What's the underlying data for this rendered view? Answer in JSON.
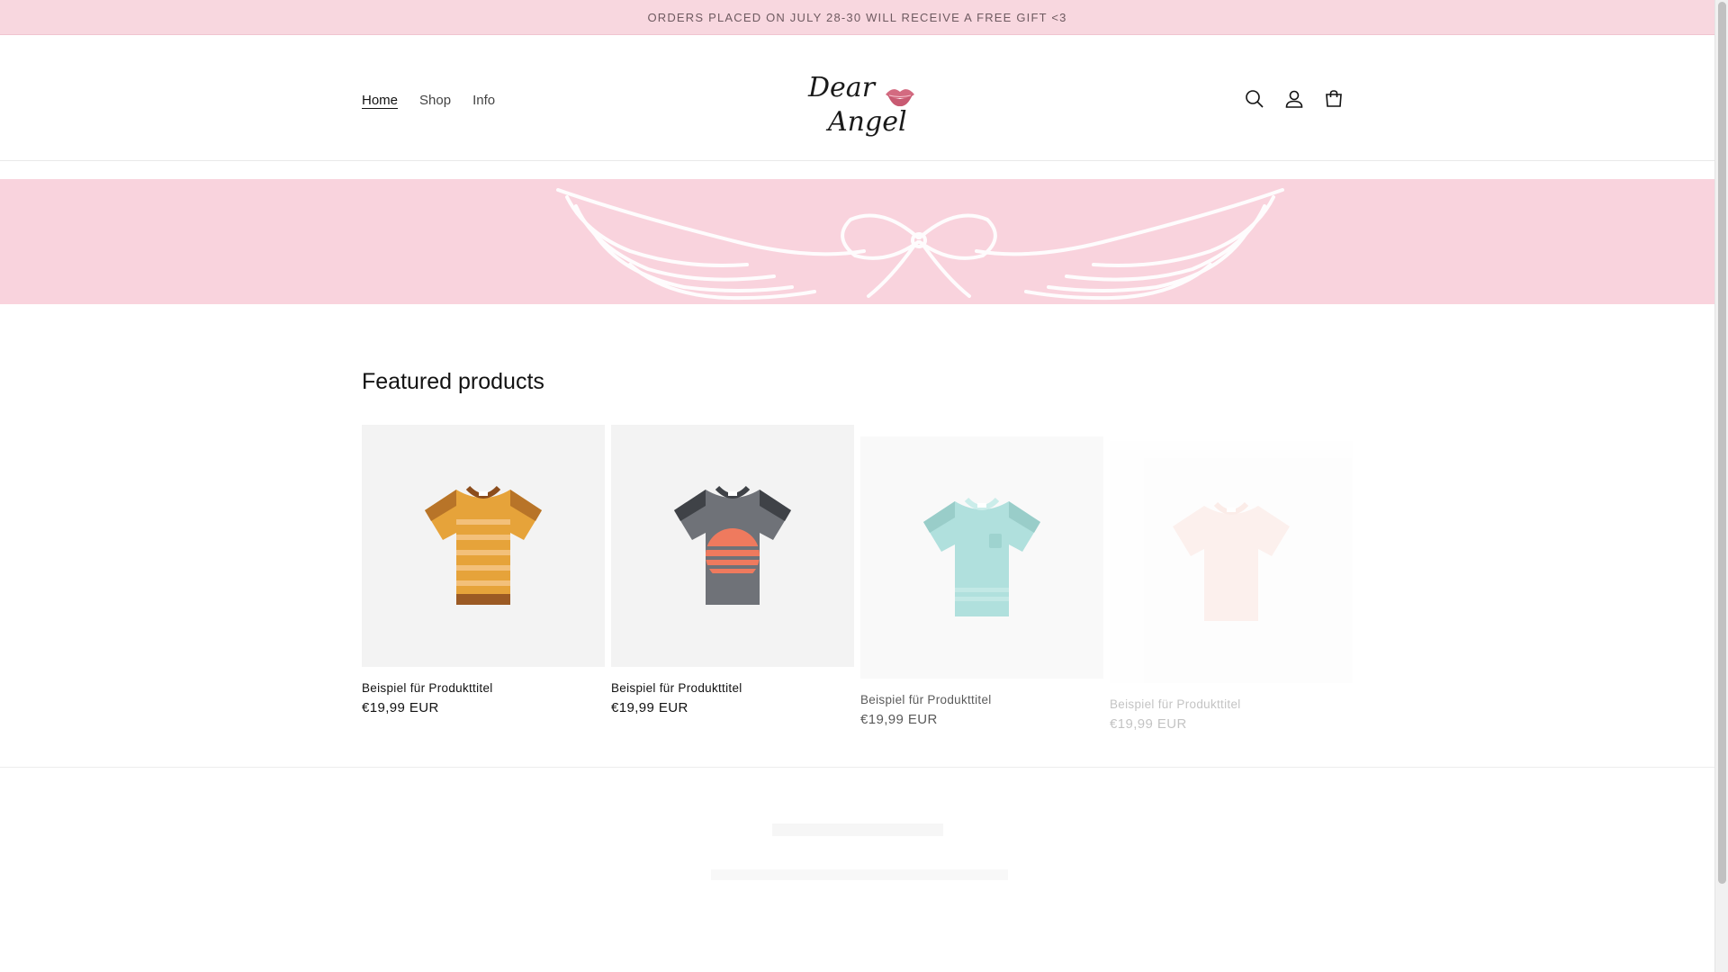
{
  "announcement": {
    "text": "ORDERS PLACED ON JULY 28-30 WILL RECEIVE A FREE GIFT <3"
  },
  "nav": {
    "items": [
      {
        "label": "Home",
        "active": true
      },
      {
        "label": "Shop",
        "active": false
      },
      {
        "label": "Info",
        "active": false
      }
    ]
  },
  "logo": {
    "line1": "Dear",
    "line2": "Angel",
    "accent": "#d36a80"
  },
  "header_icons": [
    "search-icon",
    "account-icon",
    "cart-icon"
  ],
  "hero": {
    "background": "#f9d3dd",
    "graphic": "wings-with-bow"
  },
  "featured": {
    "heading": "Featured products",
    "products": [
      {
        "title": "Beispiel für Produkttitel",
        "price": "€19,99 EUR",
        "shirt": "orange-striped"
      },
      {
        "title": "Beispiel für Produkttitel",
        "price": "€19,99 EUR",
        "shirt": "gray-sunset"
      },
      {
        "title": "Beispiel für Produkttitel",
        "price": "€19,99 EUR",
        "shirt": "mint-pocket",
        "faded": 0.7
      },
      {
        "title": "Beispiel für Produkttitel",
        "price": "€19,99 EUR",
        "shirt": "blush-plain",
        "faded": 0.25
      }
    ]
  },
  "colors": {
    "announce_bg": "#f8d7df",
    "hero_bg": "#f9d3dd",
    "text": "#121212"
  }
}
